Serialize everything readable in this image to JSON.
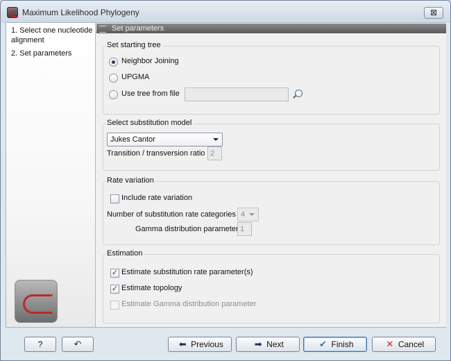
{
  "window": {
    "title": "Maximum Likelihood Phylogeny",
    "close_label": "⊠"
  },
  "steps": [
    {
      "label": "1. Select one nucleotide alignment"
    },
    {
      "label": "2. Set parameters"
    }
  ],
  "panel": {
    "header": "Set parameters",
    "starting_tree": {
      "title": "Set starting tree",
      "options": [
        {
          "label": "Neighbor Joining",
          "selected": true
        },
        {
          "label": "UPGMA",
          "selected": false
        },
        {
          "label": "Use tree from file",
          "selected": false
        }
      ],
      "file_value": ""
    },
    "substitution": {
      "title": "Select substitution model",
      "model_selected": "Jukes Cantor",
      "ratio_label": "Transition / transversion ratio",
      "ratio_value": "2"
    },
    "rate_variation": {
      "title": "Rate variation",
      "include_label": "Include rate variation",
      "include_checked": false,
      "categories_label": "Number of substitution rate categories",
      "categories_value": "4",
      "gamma_label": "Gamma distribution parameter",
      "gamma_value": "1"
    },
    "estimation": {
      "title": "Estimation",
      "options": [
        {
          "label": "Estimate substitution rate parameter(s)",
          "checked": true,
          "enabled": true
        },
        {
          "label": "Estimate topology",
          "checked": true,
          "enabled": true
        },
        {
          "label": "Estimate Gamma distribution parameter",
          "checked": false,
          "enabled": false
        }
      ]
    }
  },
  "buttons": {
    "help": "?",
    "reset": "↶",
    "previous": "Previous",
    "next": "Next",
    "finish": "Finish",
    "cancel": "Cancel"
  },
  "colors": {
    "accent": "#3d6fa5",
    "window_bg": "#dfe7ef",
    "logo_red": "#c0262e"
  }
}
